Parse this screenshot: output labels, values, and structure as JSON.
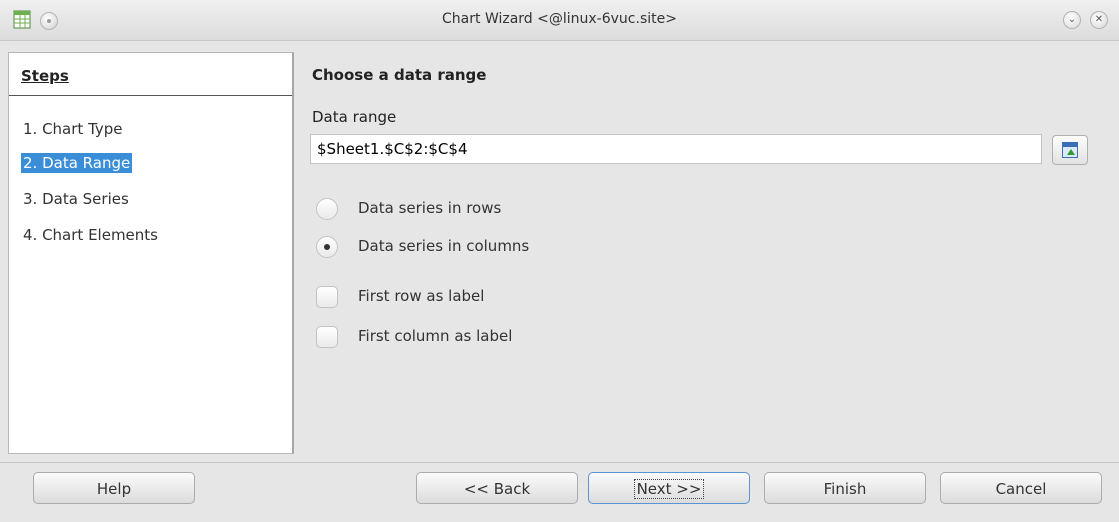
{
  "window": {
    "title": "Chart Wizard <@linux-6vuc.site>"
  },
  "steps": {
    "header": "Steps",
    "items": [
      {
        "label": "1. Chart Type",
        "active": false
      },
      {
        "label": "2. Data Range",
        "active": true
      },
      {
        "label": "3. Data Series",
        "active": false
      },
      {
        "label": "4. Chart Elements",
        "active": false
      }
    ]
  },
  "main": {
    "title": "Choose a data range",
    "range_label": "Data range",
    "range_value": "$Sheet1.$C$2:$C$4",
    "options": [
      {
        "label": "Data series in rows",
        "type": "radio",
        "checked": false
      },
      {
        "label": "Data series in columns",
        "type": "radio",
        "checked": true
      },
      {
        "label": "First row as label",
        "type": "checkbox",
        "checked": false
      },
      {
        "label": "First column as label",
        "type": "checkbox",
        "checked": false
      }
    ]
  },
  "buttons": {
    "help": "Help",
    "back": "<< Back",
    "next": "Next >>",
    "finish": "Finish",
    "cancel": "Cancel"
  },
  "icons": {
    "app": "calc-chart-icon",
    "menu": "window-menu-icon",
    "minimize": "minimize-icon",
    "close": "close-icon",
    "range_select": "select-range-icon"
  },
  "colors": {
    "selection": "#3a8ed8"
  }
}
